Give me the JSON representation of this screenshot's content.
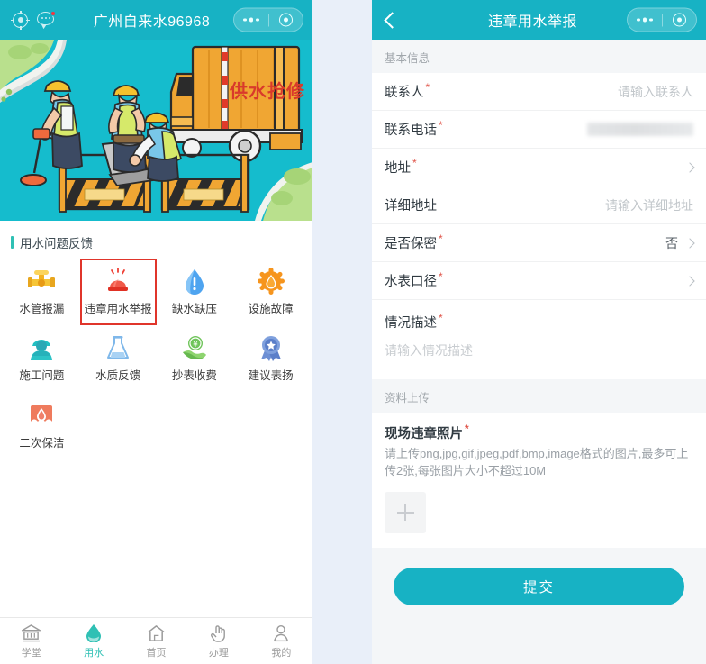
{
  "left": {
    "header": {
      "title": "广州自来水96968",
      "location_icon": "target-icon",
      "chat_icon": "chat-bubble-icon",
      "capsule_more": "ellipsis-icon",
      "capsule_close": "target-circle-icon",
      "bg_color": "#17b2c4"
    },
    "banner": {
      "truck_text": "供水抢修",
      "bg_color": "#15bccd"
    },
    "section": {
      "title": "用水问题反馈",
      "accent_color": "#2fc0b4"
    },
    "grid_items": [
      {
        "label": "水管报漏",
        "icon": "valve-icon",
        "selected": false
      },
      {
        "label": "违章用水举报",
        "icon": "alarm-light-icon",
        "selected": true
      },
      {
        "label": "缺水缺压",
        "icon": "water-drop-alert-icon",
        "selected": false
      },
      {
        "label": "设施故障",
        "icon": "gear-drop-icon",
        "selected": false
      },
      {
        "label": "施工问题",
        "icon": "worker-icon",
        "selected": false
      },
      {
        "label": "水质反馈",
        "icon": "flask-icon",
        "selected": false
      },
      {
        "label": "抄表收费",
        "icon": "hand-coin-icon",
        "selected": false
      },
      {
        "label": "建议表扬",
        "icon": "ribbon-medal-icon",
        "selected": false
      },
      {
        "label": "二次保洁",
        "icon": "tank-clean-icon",
        "selected": false
      }
    ],
    "selection_color": "#e0352b",
    "tabbar": [
      {
        "label": "学堂",
        "icon": "bank-icon",
        "active": false
      },
      {
        "label": "用水",
        "icon": "water-drop-icon",
        "active": true
      },
      {
        "label": "首页",
        "icon": "home-icon",
        "active": false
      },
      {
        "label": "办理",
        "icon": "tap-hand-icon",
        "active": false
      },
      {
        "label": "我的",
        "icon": "person-icon",
        "active": false
      }
    ],
    "tab_active_color": "#2fc0b4"
  },
  "right": {
    "header": {
      "title": "违章用水举报",
      "back_icon": "back-chevron-icon",
      "capsule_more": "ellipsis-icon",
      "capsule_close": "target-circle-icon",
      "bg_color": "#17b2c4"
    },
    "basic_group_label": "基本信息",
    "fields": [
      {
        "label": "联系人",
        "required": true,
        "placeholder": "请输入联系人",
        "value": "",
        "type": "input",
        "chevron": false
      },
      {
        "label": "联系电话",
        "required": true,
        "placeholder": "",
        "value": "",
        "type": "redacted",
        "chevron": false
      },
      {
        "label": "地址",
        "required": true,
        "placeholder": "",
        "value": "",
        "type": "select",
        "chevron": true
      },
      {
        "label": "详细地址",
        "required": false,
        "placeholder": "请输入详细地址",
        "value": "",
        "type": "input",
        "chevron": false
      },
      {
        "label": "是否保密",
        "required": true,
        "placeholder": "",
        "value": "否",
        "type": "select",
        "chevron": true
      },
      {
        "label": "水表口径",
        "required": true,
        "placeholder": "",
        "value": "",
        "type": "select",
        "chevron": true
      }
    ],
    "description": {
      "label": "情况描述",
      "required": true,
      "placeholder": "请输入情况描述",
      "value": ""
    },
    "upload_group_label": "资料上传",
    "upload": {
      "title": "现场违章照片",
      "required": true,
      "hint": "请上传png,jpg,gif,jpeg,pdf,bmp,image格式的图片,最多可上传2张,每张图片大小不超过10M",
      "add_icon": "plus-icon"
    },
    "submit_label": "提交",
    "submit_color": "#17b2c4",
    "required_mark": "*"
  }
}
